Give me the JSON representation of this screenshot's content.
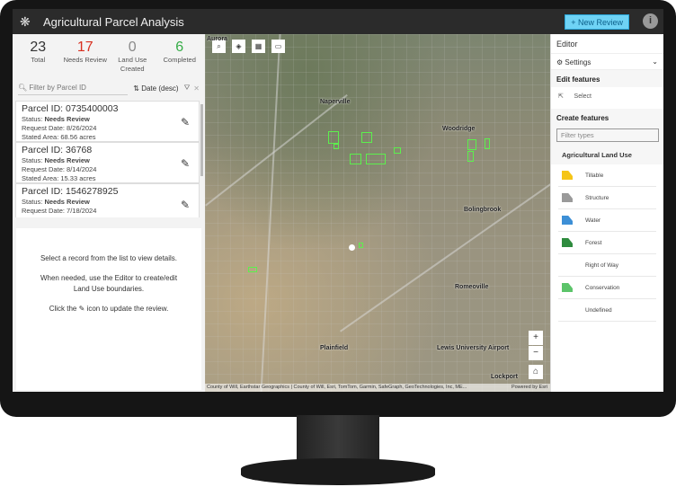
{
  "header": {
    "title": "Agricultural Parcel Analysis",
    "new_review": "+ New Review",
    "info_icon": "i"
  },
  "stats": [
    {
      "value": "23",
      "label": "Total",
      "color": "#333333"
    },
    {
      "value": "17",
      "label": "Needs Review",
      "color": "#d83020"
    },
    {
      "value": "0",
      "label": "Land Use Created",
      "color": "#8a8a8a"
    },
    {
      "value": "6",
      "label": "Completed",
      "color": "#35ac46"
    }
  ],
  "filter": {
    "placeholder": "Filter by Parcel ID",
    "sort": "Date (desc)"
  },
  "records": [
    {
      "parcel": "Parcel ID: 0735400003",
      "status_label": "Status: ",
      "status": "Needs Review",
      "date": "Request Date: 8/26/2024",
      "area": "Stated Area: 68.56 acres"
    },
    {
      "parcel": "Parcel ID: 36768",
      "status_label": "Status: ",
      "status": "Needs Review",
      "date": "Request Date: 8/14/2024",
      "area": "Stated Area: 15.33 acres"
    },
    {
      "parcel": "Parcel ID: 1546278925",
      "status_label": "Status: ",
      "status": "Needs Review",
      "date": "Request Date: 7/18/2024",
      "area": ""
    }
  ],
  "details": {
    "line1": "Select a record from the list to view details.",
    "line2": "When needed, use the Editor to create/edit Land Use boundaries.",
    "line3a": "Click the",
    "line3b": "icon to update the review."
  },
  "map": {
    "cities": [
      "Aurora",
      "Naperville",
      "Woodridge",
      "Bolingbrook",
      "Romeoville",
      "Plainfield",
      "Lewis University Airport",
      "Lockport"
    ],
    "attribution": "County of Will, Earthstar Geographics | County of Will, Esri, TomTom, Garmin, SafeGraph, GeoTechnologies, Inc, ME...",
    "powered": "Powered by Esri",
    "zoom_in": "+",
    "zoom_out": "−"
  },
  "editor": {
    "title": "Editor",
    "settings": "Settings",
    "edit_features": "Edit features",
    "select": "Select",
    "create_features": "Create features",
    "filter_placeholder": "Filter types",
    "group": "Agricultural Land Use",
    "types": [
      {
        "label": "Tillable",
        "color": "#f5c518"
      },
      {
        "label": "Structure",
        "color": "#9a9a9a"
      },
      {
        "label": "Water",
        "color": "#3d8fd6"
      },
      {
        "label": "Forest",
        "color": "#2e8b3e"
      },
      {
        "label": "Right of Way",
        "color": "#ffffff"
      },
      {
        "label": "Conservation",
        "color": "#5cc46a"
      },
      {
        "label": "Undefined",
        "color": "#ffffff"
      }
    ]
  }
}
